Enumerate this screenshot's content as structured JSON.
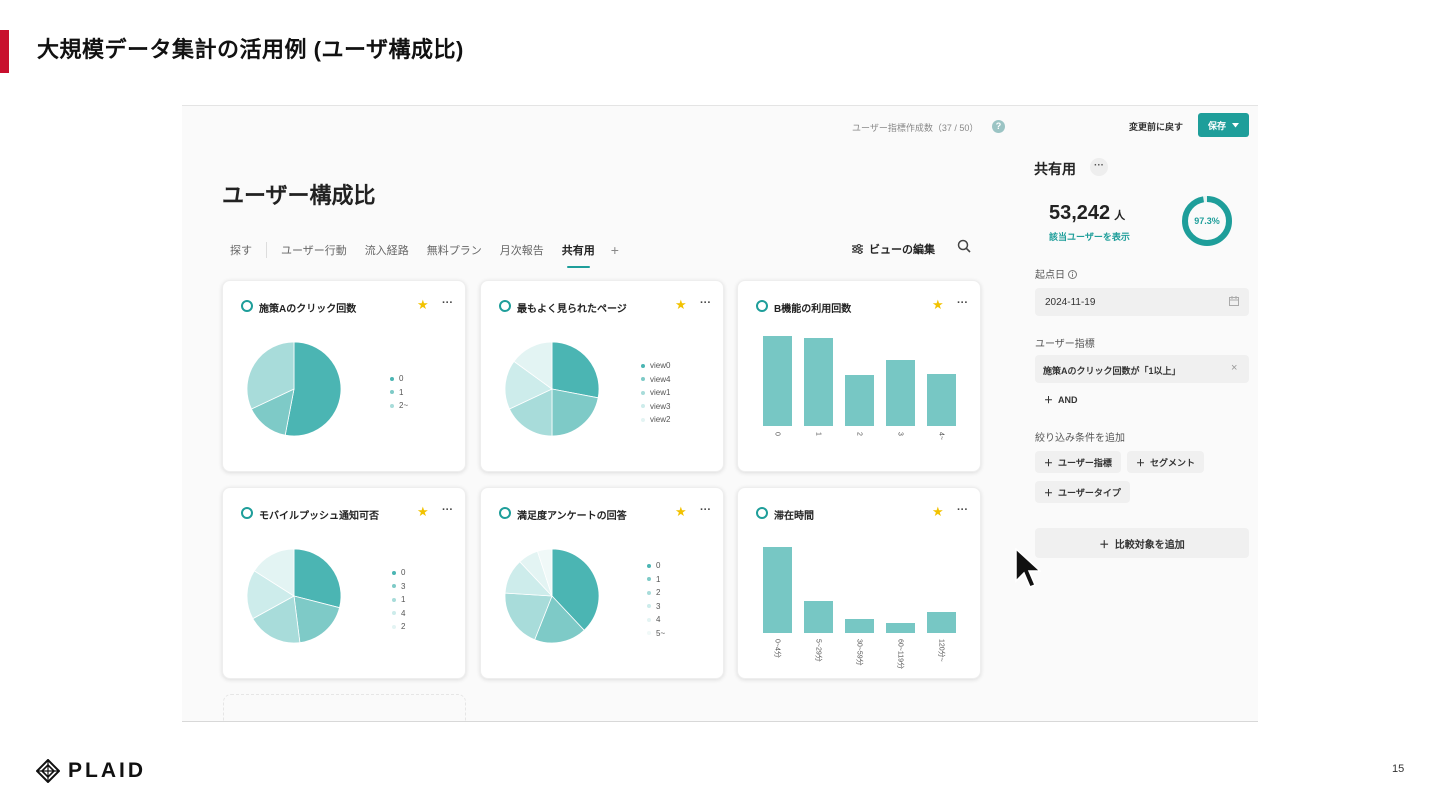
{
  "slide": {
    "title": "大規模データ集計の活用例 (ユーザ構成比)",
    "logo": "PLAID",
    "page_number": "15"
  },
  "app": {
    "metric_count": "ユーザー指標作成数（37 / 50）",
    "help": "?",
    "revert_label": "変更前に戻す",
    "save_label": "保存",
    "page_title": "ユーザー構成比",
    "tabs": [
      "探す",
      "ユーザー行動",
      "流入経路",
      "無料プラン",
      "月次報告",
      "共有用"
    ],
    "active_tab": "共有用",
    "add_tab": "+",
    "edit_view_label": "ビューの編集"
  },
  "cards": [
    {
      "title": "施策Aのクリック回数",
      "legend": [
        "0",
        "1",
        "2~"
      ]
    },
    {
      "title": "最もよく見られたページ",
      "legend": [
        "view0",
        "view4",
        "view1",
        "view3",
        "view2"
      ]
    },
    {
      "title": "B機能の利用回数",
      "legend": []
    },
    {
      "title": "モバイルプッシュ通知可否",
      "legend": [
        "0",
        "3",
        "1",
        "4",
        "2"
      ]
    },
    {
      "title": "満足度アンケートの回答",
      "legend": [
        "0",
        "1",
        "2",
        "3",
        "4",
        "5~"
      ]
    },
    {
      "title": "滞在時間",
      "legend": []
    }
  ],
  "colors": {
    "accent": "#1e9e9a",
    "shades": [
      "#4bb5b3",
      "#7ecac7",
      "#a8dcda",
      "#cdeceb",
      "#e3f4f3",
      "#f0f9f8"
    ],
    "brand_red": "#c8102e",
    "star": "#f2c200"
  },
  "chart_data": [
    {
      "type": "pie",
      "title": "施策Aのクリック回数",
      "categories": [
        "0",
        "1",
        "2~"
      ],
      "values": [
        53,
        15,
        32
      ]
    },
    {
      "type": "pie",
      "title": "最もよく見られたページ",
      "categories": [
        "view0",
        "view4",
        "view1",
        "view3",
        "view2"
      ],
      "values": [
        28,
        22,
        18,
        17,
        15
      ]
    },
    {
      "type": "bar",
      "title": "B機能の利用回数",
      "categories": [
        "0",
        "1",
        "2",
        "3",
        "4~"
      ],
      "values": [
        90,
        88,
        51,
        66,
        52
      ],
      "ylim": [
        0,
        100
      ]
    },
    {
      "type": "pie",
      "title": "モバイルプッシュ通知可否",
      "categories": [
        "0",
        "3",
        "1",
        "4",
        "2"
      ],
      "values": [
        29,
        19,
        19,
        17,
        16
      ]
    },
    {
      "type": "pie",
      "title": "満足度アンケートの回答",
      "categories": [
        "0",
        "1",
        "2",
        "3",
        "4",
        "5~"
      ],
      "values": [
        38,
        18,
        20,
        12,
        7,
        5
      ]
    },
    {
      "type": "bar",
      "title": "滞在時間",
      "categories": [
        "0~4分",
        "5~29分",
        "30~59分",
        "60~119分",
        "120分~"
      ],
      "values": [
        86,
        32,
        14,
        10,
        21
      ],
      "ylim": [
        0,
        100
      ]
    }
  ],
  "panel": {
    "title": "共有用",
    "more": "···",
    "users_count": "53,242",
    "users_unit": "人",
    "users_link": "該当ユーザーを表示",
    "donut_pct": "97.3%",
    "donut_fraction": 0.973,
    "start_date_label": "起点日",
    "start_date": "2024-11-19",
    "metric_label": "ユーザー指標",
    "condition": "施策Aのクリック回数が「1以上」",
    "and_label": "AND",
    "filter_label": "絞り込み条件を追加",
    "chips": [
      "ユーザー指標",
      "セグメント",
      "ユーザータイプ"
    ],
    "compare_label": "比較対象を追加"
  }
}
